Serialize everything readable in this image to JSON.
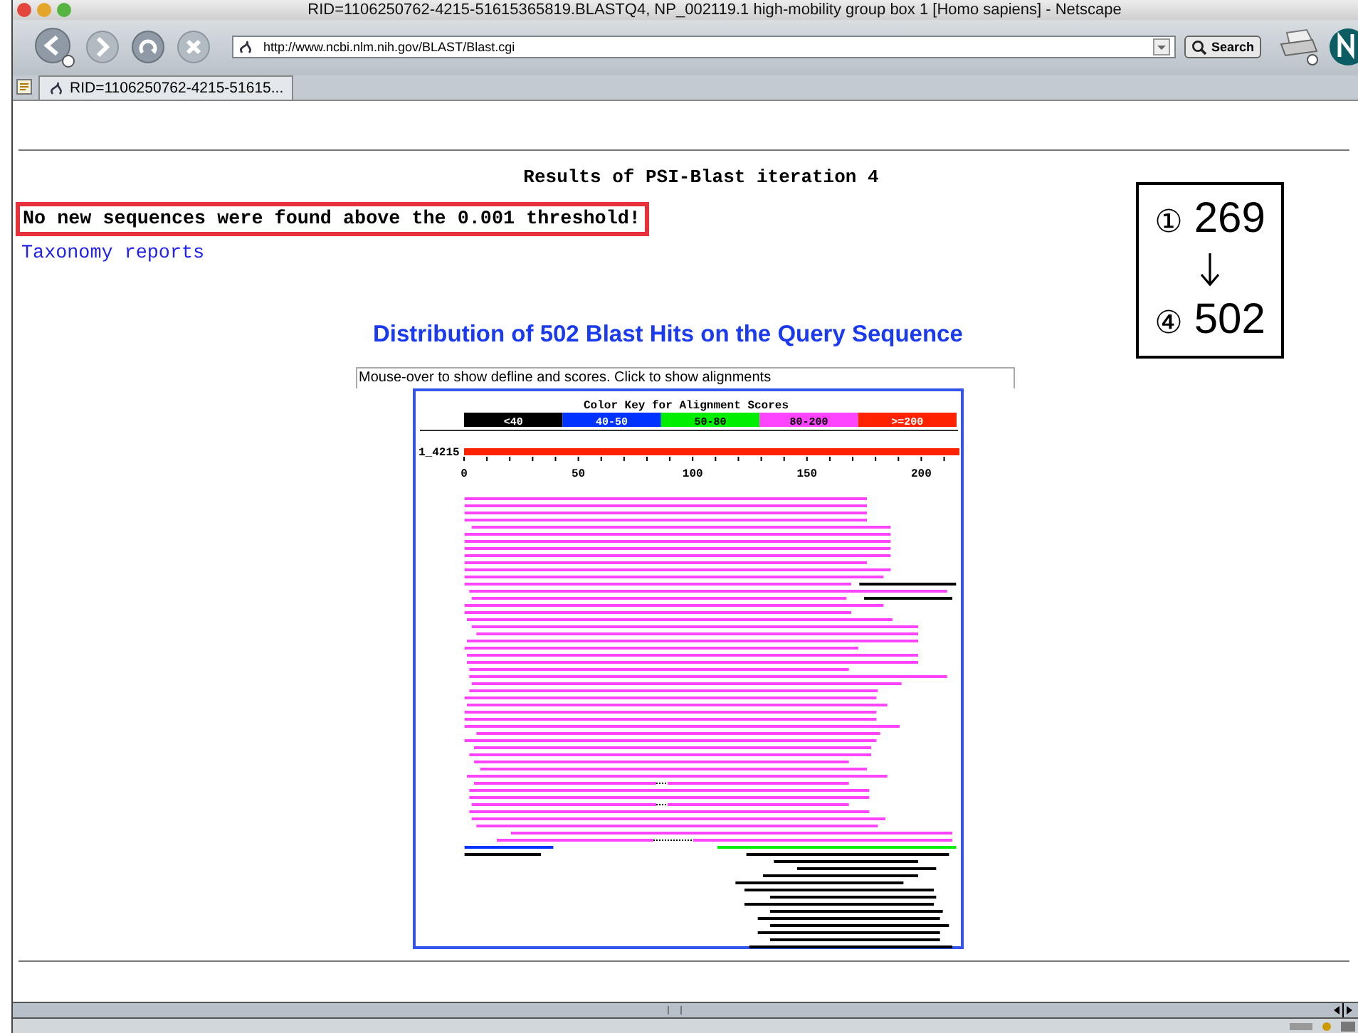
{
  "window": {
    "title": "RID=1106250762-4215-51615365819.BLASTQ4, NP_002119.1 high-mobility group box 1 [Homo sapiens] - Netscape"
  },
  "address_bar": {
    "value": "http://www.ncbi.nlm.nih.gov/BLAST/Blast.cgi"
  },
  "search_button": {
    "label": "Search"
  },
  "tabs": [
    {
      "label": "RID=1106250762-4215-51615...",
      "selected": true
    }
  ],
  "page": {
    "heading": "Results of PSI-Blast iteration 4",
    "notice": "No new sequences were found above the 0.001 threshold!",
    "link": "Taxonomy reports",
    "annotation": {
      "first_marker": "①",
      "first_value": "269",
      "second_marker": "④",
      "second_value": "502"
    },
    "distribution": {
      "title": "Distribution of 502 Blast Hits on the Query Sequence",
      "hint": "Mouse-over to show defline and scores. Click to show alignments",
      "key_title": "Color Key for Alignment Scores",
      "key": [
        {
          "label": "<40",
          "color": "#000000"
        },
        {
          "label": "40-50",
          "color": "#0033ff"
        },
        {
          "label": "50-80",
          "color": "#00ee00"
        },
        {
          "label": "80-200",
          "color": "#ff44ff"
        },
        {
          "label": ">=200",
          "color": "#ff2200"
        }
      ],
      "query_label": "1_4215",
      "ticks": [
        "0",
        "50",
        "100",
        "150",
        "200"
      ]
    }
  }
}
